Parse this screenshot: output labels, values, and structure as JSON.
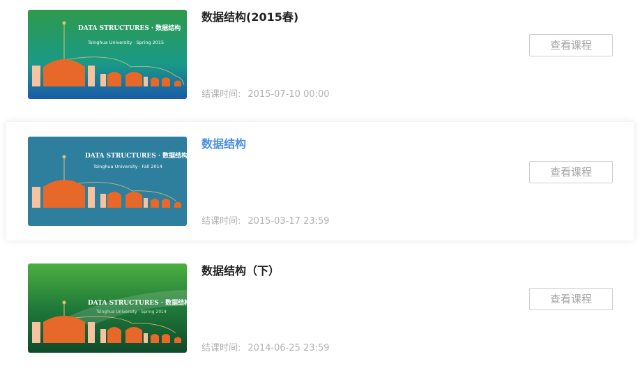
{
  "courses": [
    {
      "title": "数据结构(2015春)",
      "end_label": "结课时间:",
      "end_time": "2015-07-10 00:00",
      "button_label": "查看课程",
      "active": false,
      "thumbnail": {
        "heading": "DATA STRUCTURES · 数据结构",
        "subheading": "Tsinghua University · Spring 2015",
        "colors": {
          "top": "#2f9a4d",
          "middle": "#1a9a86",
          "bottom": "#1a5aa8",
          "building": "#e8682a",
          "pillar": "#f7c2a0"
        }
      }
    },
    {
      "title": "数据结构",
      "end_label": "结课时间:",
      "end_time": "2015-03-17 23:59",
      "button_label": "查看课程",
      "active": true,
      "thumbnail": {
        "heading": "DATA STRUCTURES · 数据结构",
        "subheading": "Tsinghua University · Fall 2014",
        "colors": {
          "top": "#2f7e9c",
          "middle": "#2e7f9d",
          "bottom": "#2d7b98",
          "building": "#e8682a",
          "pillar": "#f7c2a0"
        }
      }
    },
    {
      "title": "数据结构（下）",
      "end_label": "结课时间:",
      "end_time": "2014-06-25 23:59",
      "button_label": "查看课程",
      "active": false,
      "thumbnail": {
        "heading": "DATA STRUCTURES · 数据结构",
        "subheading": "Tsinghua University · Spring 2014",
        "colors": {
          "top": "#4caf3f",
          "middle": "#1f7a3a",
          "bottom": "#0f4a2a",
          "building": "#e8682a",
          "pillar": "#f7c2a0"
        }
      }
    }
  ],
  "colors": {
    "active_title": "#4a8ee8",
    "title": "#222222",
    "meta_text": "#b2b2b2",
    "button_border": "#cfcfcf",
    "button_text": "#a6a6a6"
  }
}
